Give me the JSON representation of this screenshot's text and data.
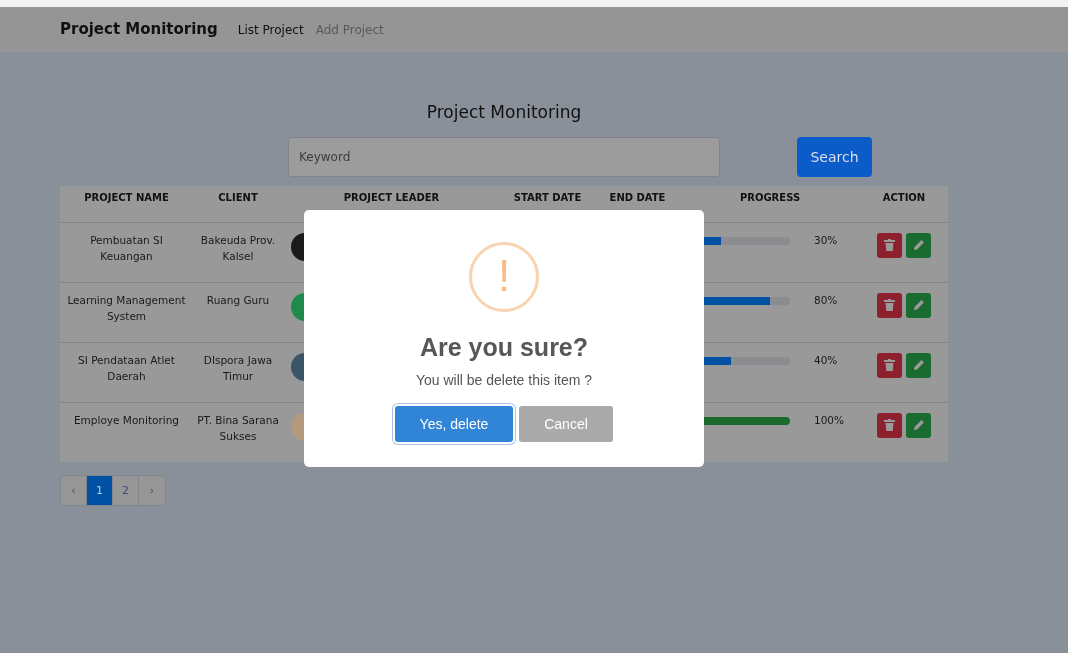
{
  "navbar": {
    "brand": "Project Monitoring",
    "links": [
      {
        "label": "List Project",
        "active": true
      },
      {
        "label": "Add Project",
        "active": false
      }
    ]
  },
  "page_title": "Project Monitoring",
  "search": {
    "placeholder": "Keyword",
    "button": "Search"
  },
  "table": {
    "columns": [
      "PROJECT NAME",
      "CLIENT",
      "PROJECT LEADER",
      "START DATE",
      "END DATE",
      "PROGRESS",
      "ACTION"
    ],
    "rows": [
      {
        "project_name": "Pembuatan SI Keuangan",
        "client": "Bakeuda Prov. Kalsel",
        "leader_avatar": {
          "color": "#1a1a1a"
        },
        "progress": {
          "level": 0.3,
          "reading": "30%",
          "color": "#0050a4"
        }
      },
      {
        "project_name": "Learning Management System",
        "client": "Ruang Guru",
        "leader_avatar": {
          "color": "#1e8a4c"
        },
        "progress": {
          "level": 0.8,
          "reading": "80%",
          "color": "#0050a4"
        }
      },
      {
        "project_name": "SI Pendataan Atlet Daerah",
        "client": "DIspora Jawa Timur",
        "leader_avatar": {
          "color": "#3a5468"
        },
        "progress": {
          "level": 0.4,
          "reading": "40%",
          "color": "#0050a4"
        }
      },
      {
        "project_name": "Employe Monitoring",
        "client": "PT. Bina Sarana Sukses",
        "leader_avatar": {
          "color": "#b49a7c"
        },
        "progress": {
          "level": 1,
          "reading": "100%",
          "color": "#1a6b2c"
        }
      }
    ]
  },
  "pagination": [
    {
      "label": "‹",
      "selected": false
    },
    {
      "label": "1",
      "selected": true
    },
    {
      "label": "2",
      "selected": false
    },
    {
      "label": "›",
      "selected": false
    }
  ],
  "dialog": {
    "icon": "!",
    "title": "Are you sure?",
    "message": "You will be delete this item ?",
    "buttons": [
      {
        "label": "Yes, delete",
        "kind": "confirm",
        "focused": true
      },
      {
        "label": "Cancel",
        "kind": "cancel",
        "focused": false
      }
    ]
  }
}
